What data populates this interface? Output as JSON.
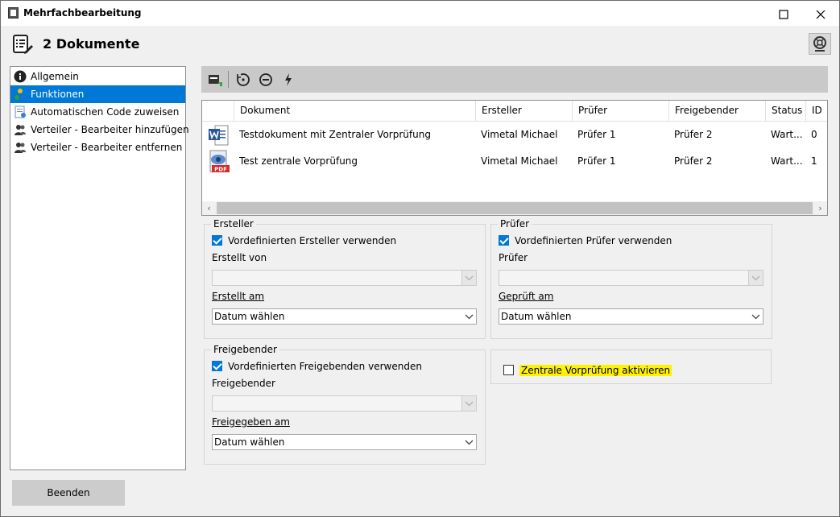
{
  "window": {
    "title": "Mehrfachbearbeitung"
  },
  "header": {
    "title": "2 Dokumente"
  },
  "nav": {
    "items": [
      {
        "label": "Allgemein"
      },
      {
        "label": "Funktionen"
      },
      {
        "label": "Automatischen Code zuweisen"
      },
      {
        "label": "Verteiler - Bearbeiter hinzufügen"
      },
      {
        "label": "Verteiler - Bearbeiter entfernen"
      }
    ]
  },
  "grid": {
    "columns": [
      "Dokument",
      "Ersteller",
      "Prüfer",
      "Freigebender",
      "Status",
      "ID"
    ],
    "rows": [
      {
        "icon": "word-icon",
        "dokument": "Testdokument mit Zentraler Vorprüfung",
        "ersteller": "Vimetal Michael",
        "pruefer": "Prüfer 1",
        "freigebender": "Prüfer 2",
        "status": "Wart...",
        "id": "0"
      },
      {
        "icon": "pdf-icon",
        "dokument": "Test zentrale Vorprüfung",
        "ersteller": "Vimetal Michael",
        "pruefer": "Prüfer 1",
        "freigebender": "Prüfer 2",
        "status": "Wart...",
        "id": "1"
      }
    ]
  },
  "ersteller": {
    "legend": "Ersteller",
    "checkbox_label": "Vordefinierten Ersteller verwenden",
    "checked": true,
    "person_label": "Erstellt von",
    "person_value": "",
    "date_label": "Erstellt am",
    "date_value": "Datum wählen"
  },
  "pruefer": {
    "legend": "Prüfer",
    "checkbox_label": "Vordefinierten Prüfer verwenden",
    "checked": true,
    "person_label": "Prüfer",
    "person_value": "",
    "date_label": "Geprüft am",
    "date_value": "Datum wählen"
  },
  "freigebender": {
    "legend": "Freigebender",
    "checkbox_label": "Vordefinierten Freigebenden verwenden",
    "checked": true,
    "person_label": "Freigebender",
    "person_value": "",
    "date_label": "Freigegeben am",
    "date_value": "Datum wählen"
  },
  "zentrale": {
    "checkbox_label": "Zentrale Vorprüfung aktivieren",
    "checked": false,
    "highlight_color": "#fff200"
  },
  "footer": {
    "end_button": "Beenden"
  },
  "colors": {
    "selection": "#0078d7",
    "toolbar": "#c9c9c9",
    "background": "#f0f0f0"
  }
}
